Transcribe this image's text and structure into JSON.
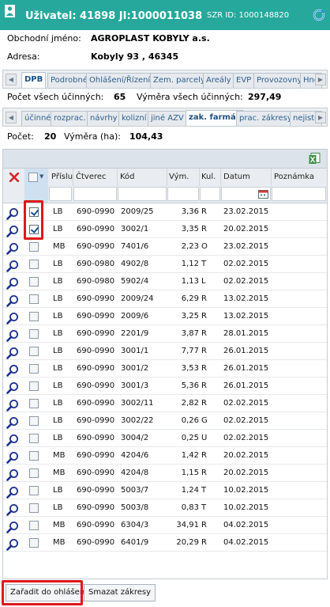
{
  "header": {
    "title": "Uživatel: 41898 JI:1000011038",
    "szr": "SZR ID: 1000148820"
  },
  "info": {
    "name_label": "Obchodní jméno:",
    "name_value": "AGROPLAST KOBYLY a.s.",
    "address_label": "Adresa:",
    "address_value": "Kobyly 93 , 46345"
  },
  "tabs_main": {
    "items": [
      "DPB",
      "Podrobné",
      "Ohlášení/Řízení",
      "Zem. parcely",
      "Areály",
      "EVP",
      "Provozovny",
      "Hno"
    ],
    "active": "DPB"
  },
  "stats_main": {
    "count_label": "Počet všech účinných:",
    "count_value": "65",
    "area_label": "Výměra všech účinných:",
    "area_value": "297,49"
  },
  "tabs_sub": {
    "items": [
      "účinné",
      "rozprac.",
      "návrhy",
      "kolizní",
      "jiné AZV",
      "zak. farmář",
      "prac. zákresy",
      "nejiste"
    ],
    "active": "zak. farmář"
  },
  "stats_sub": {
    "count_label": "Počet:",
    "count_value": "20",
    "area_label": "Výměra (ha):",
    "area_value": "104,43"
  },
  "grid": {
    "columns": [
      "Příslu",
      "Čtverec",
      "Kód",
      "Vým.",
      "Kul.",
      "Datum",
      "Poznámka"
    ],
    "rows": [
      {
        "checked": true,
        "prislus": "LB",
        "ctverec": "690-0990",
        "kod": "2009/25",
        "vym": "3,36",
        "kul": "R",
        "datum": "23.02.2015"
      },
      {
        "checked": true,
        "prislus": "LB",
        "ctverec": "690-0990",
        "kod": "3002/1",
        "vym": "3,35",
        "kul": "R",
        "datum": "20.02.2015"
      },
      {
        "checked": false,
        "prislus": "MB",
        "ctverec": "690-0990",
        "kod": "7401/6",
        "vym": "2,23",
        "kul": "O",
        "datum": "23.02.2015"
      },
      {
        "checked": false,
        "prislus": "LB",
        "ctverec": "690-0980",
        "kod": "4902/8",
        "vym": "1,12",
        "kul": "T",
        "datum": "02.02.2015"
      },
      {
        "checked": false,
        "prislus": "LB",
        "ctverec": "690-0980",
        "kod": "5902/4",
        "vym": "1,13",
        "kul": "L",
        "datum": "02.02.2015"
      },
      {
        "checked": false,
        "prislus": "LB",
        "ctverec": "690-0990",
        "kod": "2009/24",
        "vym": "6,29",
        "kul": "R",
        "datum": "13.02.2015"
      },
      {
        "checked": false,
        "prislus": "LB",
        "ctverec": "690-0990",
        "kod": "2009/6",
        "vym": "3,25",
        "kul": "R",
        "datum": "13.02.2015"
      },
      {
        "checked": false,
        "prislus": "LB",
        "ctverec": "690-0990",
        "kod": "2201/9",
        "vym": "3,87",
        "kul": "R",
        "datum": "28.01.2015"
      },
      {
        "checked": false,
        "prislus": "LB",
        "ctverec": "690-0990",
        "kod": "3001/1",
        "vym": "7,77",
        "kul": "R",
        "datum": "26.01.2015"
      },
      {
        "checked": false,
        "prislus": "LB",
        "ctverec": "690-0990",
        "kod": "3001/2",
        "vym": "3,53",
        "kul": "R",
        "datum": "26.01.2015"
      },
      {
        "checked": false,
        "prislus": "LB",
        "ctverec": "690-0990",
        "kod": "3001/3",
        "vym": "5,36",
        "kul": "R",
        "datum": "26.01.2015"
      },
      {
        "checked": false,
        "prislus": "LB",
        "ctverec": "690-0990",
        "kod": "3002/11",
        "vym": "2,82",
        "kul": "R",
        "datum": "02.02.2015"
      },
      {
        "checked": false,
        "prislus": "LB",
        "ctverec": "690-0990",
        "kod": "3002/22",
        "vym": "0,26",
        "kul": "G",
        "datum": "02.02.2015"
      },
      {
        "checked": false,
        "prislus": "LB",
        "ctverec": "690-0990",
        "kod": "3004/2",
        "vym": "0,25",
        "kul": "U",
        "datum": "02.02.2015"
      },
      {
        "checked": false,
        "prislus": "MB",
        "ctverec": "690-0990",
        "kod": "4204/6",
        "vym": "1,42",
        "kul": "R",
        "datum": "20.02.2015"
      },
      {
        "checked": false,
        "prislus": "MB",
        "ctverec": "690-0990",
        "kod": "4204/8",
        "vym": "1,15",
        "kul": "R",
        "datum": "20.02.2015"
      },
      {
        "checked": false,
        "prislus": "LB",
        "ctverec": "690-0990",
        "kod": "5003/7",
        "vym": "1,24",
        "kul": "T",
        "datum": "10.02.2015"
      },
      {
        "checked": false,
        "prislus": "LB",
        "ctverec": "690-0990",
        "kod": "5003/8",
        "vym": "0,83",
        "kul": "T",
        "datum": "10.02.2015"
      },
      {
        "checked": false,
        "prislus": "MB",
        "ctverec": "690-0990",
        "kod": "6304/3",
        "vym": "34,91",
        "kul": "R",
        "datum": "04.02.2015"
      },
      {
        "checked": false,
        "prislus": "MB",
        "ctverec": "690-0990",
        "kod": "6401/9",
        "vym": "20,29",
        "kul": "R",
        "datum": "04.02.2015"
      }
    ]
  },
  "buttons": {
    "assign": "Zařadit do ohlášení",
    "delete": "Smazat zákresy"
  },
  "colors": {
    "header_bg": "#26a89c",
    "highlight": "#e0161b",
    "link": "#2f5e8c"
  },
  "icons": [
    "user-icon",
    "refresh-icon",
    "arrow-left-icon",
    "arrow-right-icon",
    "excel-export-icon",
    "delete-filter-icon",
    "checkbox-dropdown-icon",
    "calendar-icon",
    "magnifier-icon"
  ]
}
